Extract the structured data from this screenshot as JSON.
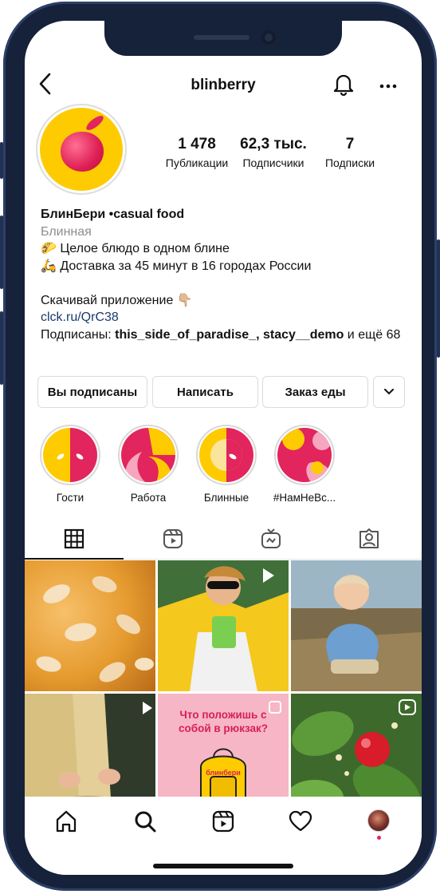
{
  "profile": {
    "username": "blinberry",
    "stats": [
      {
        "value": "1 478",
        "label": "Публикации"
      },
      {
        "value": "62,3 тыс.",
        "label": "Подписчики"
      },
      {
        "value": "7",
        "label": "Подписки"
      }
    ],
    "display_name": "БлинБери •casual food",
    "category": "Блинная",
    "bio_line_1": "🌮 Целое блюдо в одном блине",
    "bio_line_2": "🛵 Доставка за 45 минут в 16 городах России",
    "bio_line_3": "Скачивай приложение 👇🏼",
    "link": "clck.ru/QrC38",
    "followed_by_prefix": "Подписаны: ",
    "followed_by_names": "this_side_of_paradise_, stacy__demo",
    "followed_by_suffix": " и ещё 68"
  },
  "actions": {
    "following": "Вы подписаны",
    "message": "Написать",
    "order_food": "Заказ еды"
  },
  "highlights": [
    {
      "label": "Гости"
    },
    {
      "label": "Работа"
    },
    {
      "label": "Блинные"
    },
    {
      "label": "#НамНеВс..."
    }
  ],
  "posts": {
    "post5_text": "Что положишь с собой в рюкзак?",
    "post5_brand": "блинбери"
  },
  "colors": {
    "brand_yellow": "#FECB00",
    "brand_red": "#E2255C",
    "link_blue": "#1A3A6E",
    "phone_frame": "#16213A"
  },
  "icons": [
    "back-arrow-icon",
    "bell-icon",
    "more-icon",
    "grid-icon",
    "reels-icon",
    "igtv-icon",
    "tagged-icon",
    "home-icon",
    "search-icon",
    "reels-nav-icon",
    "heart-icon",
    "profile-avatar-icon",
    "video-icon",
    "carousel-icon"
  ]
}
